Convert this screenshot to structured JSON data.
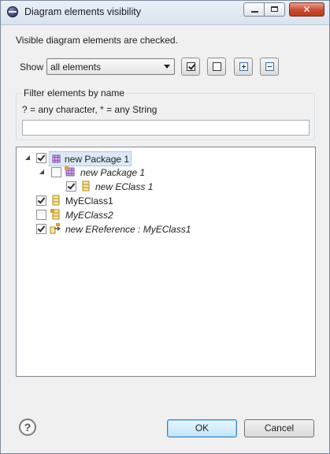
{
  "window": {
    "title": "Diagram elements visibility",
    "icon": "eclipse-icon"
  },
  "message": "Visible diagram elements are checked.",
  "show": {
    "label": "Show",
    "selected": "all elements"
  },
  "toolbar": {
    "check_all_icon": "check-all-icon",
    "uncheck_all_icon": "uncheck-all-icon",
    "expand_all_icon": "expand-all-icon",
    "collapse_all_icon": "collapse-all-icon"
  },
  "filter": {
    "group_label": "Filter elements by name",
    "hint": "? = any character, * = any String",
    "value": ""
  },
  "tree": [
    {
      "label": "new Package 1",
      "checked": true,
      "italic": false,
      "selected": true,
      "icon": "package-icon",
      "expanded": true
    },
    {
      "label": "new Package 1",
      "checked": false,
      "italic": true,
      "selected": false,
      "icon": "package-icon",
      "expanded": true
    },
    {
      "label": "new EClass 1",
      "checked": true,
      "italic": true,
      "selected": false,
      "icon": "eclass-icon"
    },
    {
      "label": "MyEClass1",
      "checked": true,
      "italic": false,
      "selected": false,
      "icon": "eclass-icon"
    },
    {
      "label": "MyEClass2",
      "checked": false,
      "italic": true,
      "selected": false,
      "icon": "eclass-icon"
    },
    {
      "label": "new EReference : MyEClass1",
      "checked": true,
      "italic": true,
      "selected": false,
      "icon": "ereference-icon"
    }
  ],
  "buttons": {
    "ok": "OK",
    "cancel": "Cancel",
    "help": "?"
  },
  "colors": {
    "selection": "#dde9f7",
    "default_button": "#bee6fd",
    "close_button": "#c94b2d"
  }
}
